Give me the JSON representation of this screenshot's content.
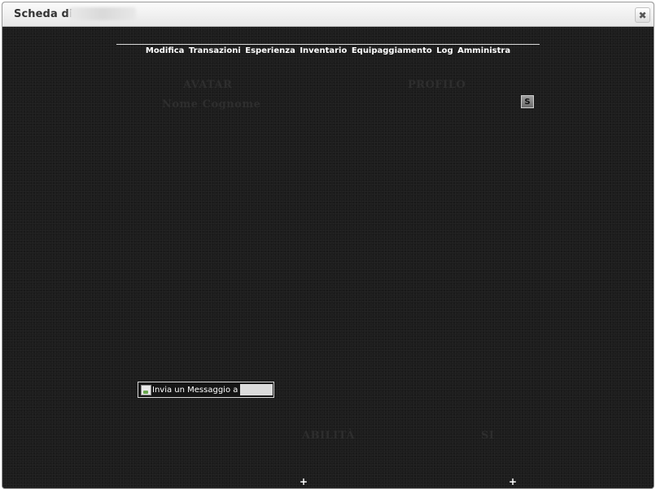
{
  "window": {
    "title": "Scheda di",
    "close_glyph": "✖"
  },
  "nav": {
    "items": [
      {
        "label": "Modifica"
      },
      {
        "label": "Transazioni"
      },
      {
        "label": "Esperienza"
      },
      {
        "label": "Inventario"
      },
      {
        "label": "Equipaggiamento"
      },
      {
        "label": "Log"
      },
      {
        "label": "Amministra"
      }
    ]
  },
  "faded_labels": {
    "avatar": "AVATAR",
    "name_line": "Nome Cognome",
    "profilo": "PROFILO",
    "abilita": "ABILITÀ",
    "right_bottom": "SI"
  },
  "profile_icon": {
    "glyph": "S",
    "icon": "edit-square-icon"
  },
  "message_button": {
    "label": "Invia un Messaggio a",
    "icon": "broken-image-icon"
  },
  "expanders": {
    "left": "+",
    "right": "+"
  },
  "colors": {
    "content_bg": "#1d1d1d",
    "titlebar_top": "#fbfbfb",
    "titlebar_bottom": "#e6e6e6",
    "nav_text": "#ffffff"
  }
}
